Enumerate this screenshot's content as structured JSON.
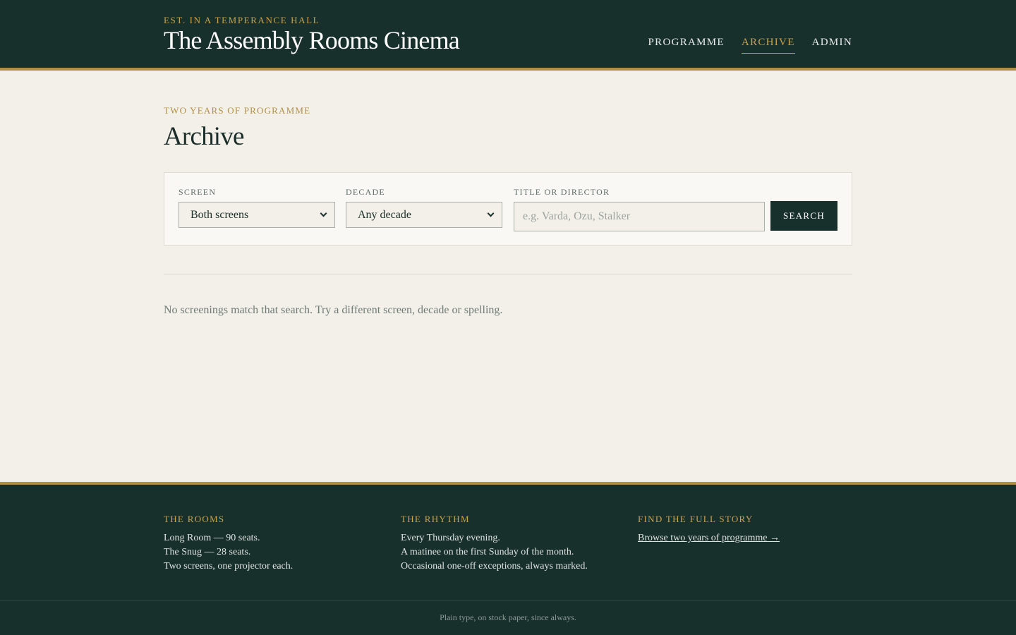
{
  "header": {
    "kicker": "EST. IN A TEMPERANCE HALL",
    "title": "The Assembly Rooms Cinema",
    "nav": [
      {
        "label": "PROGRAMME",
        "active": false
      },
      {
        "label": "ARCHIVE",
        "active": true
      },
      {
        "label": "ADMIN",
        "active": false
      }
    ]
  },
  "main": {
    "eyebrow": "TWO YEARS OF PROGRAMME",
    "title": "Archive",
    "filters": {
      "screen": {
        "label": "SCREEN",
        "value": "Both screens"
      },
      "decade": {
        "label": "DECADE",
        "value": "Any decade"
      },
      "query": {
        "label": "TITLE OR DIRECTOR",
        "value": "",
        "placeholder": "e.g. Varda, Ozu, Stalker"
      },
      "search_label": "SEARCH"
    },
    "empty_message": "No screenings match that search. Try a different screen, decade or spelling."
  },
  "footer": {
    "rooms": {
      "heading": "THE ROOMS",
      "lines": [
        "Long Room — 90 seats.",
        "The Snug — 28 seats.",
        "Two screens, one projector each."
      ]
    },
    "rhythm": {
      "heading": "THE RHYTHM",
      "lines": [
        "Every Thursday evening.",
        "A matinee on the first Sunday of the month.",
        "Occasional one-off exceptions, always marked."
      ]
    },
    "story": {
      "heading": "FIND THE FULL STORY",
      "link": "Browse two years of programme →"
    },
    "tagline": "Plain type, on stock paper, since always."
  },
  "colors": {
    "header_bg": "#17302b",
    "accent_gold": "#b08f45",
    "page_bg": "#f3f0ea"
  }
}
